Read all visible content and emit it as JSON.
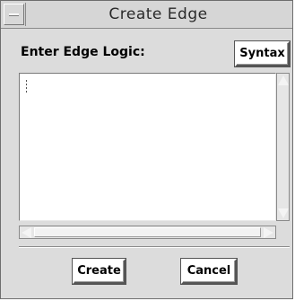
{
  "window": {
    "title": "Create Edge"
  },
  "dialog": {
    "prompt_label": "Enter Edge Logic:",
    "syntax_label": "Syntax",
    "logic_value": "",
    "create_label": "Create",
    "cancel_label": "Cancel"
  },
  "icons": {
    "window_menu": "minus-bar-icon",
    "scroll_up": "triangle-up-icon",
    "scroll_down": "triangle-down-icon",
    "scroll_left": "triangle-left-icon",
    "scroll_right": "triangle-right-icon"
  },
  "colors": {
    "window_bg": "#dcdcdc",
    "text_area_bg": "#ffffff",
    "button_bg": "#ffffff"
  }
}
